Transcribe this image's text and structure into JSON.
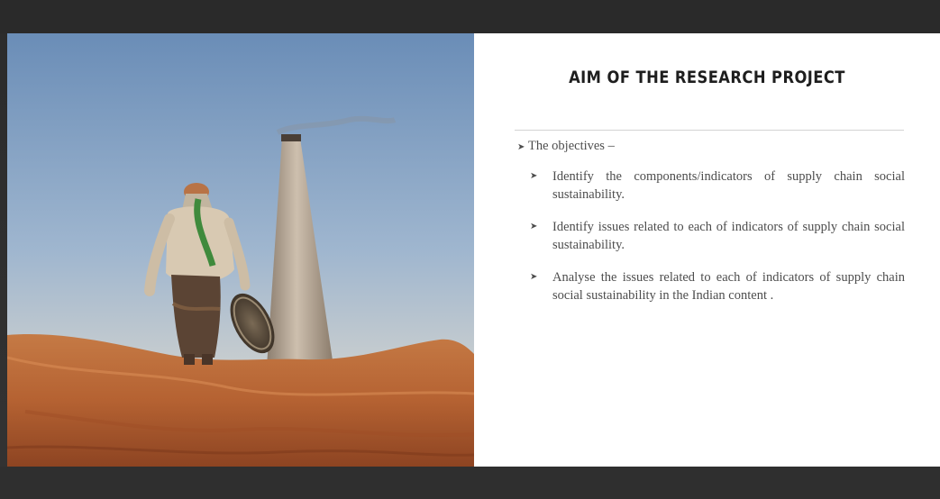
{
  "slide": {
    "title": "AIM OF THE RESEARCH PROJECT",
    "intro": "The objectives –",
    "bullet_symbol": "➤",
    "objectives": [
      "Identify the components/indicators of supply chain social sustainability.",
      "Identify issues related to each of indicators of supply chain social sustainability.",
      "Analyse the issues related to each of indicators of supply chain social sustainability in the Indian content ."
    ]
  },
  "photo": {
    "subject": "worker-carrying-basket-near-brick-kiln-chimney"
  },
  "colors": {
    "frame": "#2e2e2e",
    "slide_background": "#ffffff",
    "title": "#1e1e1e",
    "body_text": "#4d4d4d",
    "rule": "#d3d3d3",
    "sky_top": "#6d8fb8",
    "earth": "#b8693a"
  }
}
